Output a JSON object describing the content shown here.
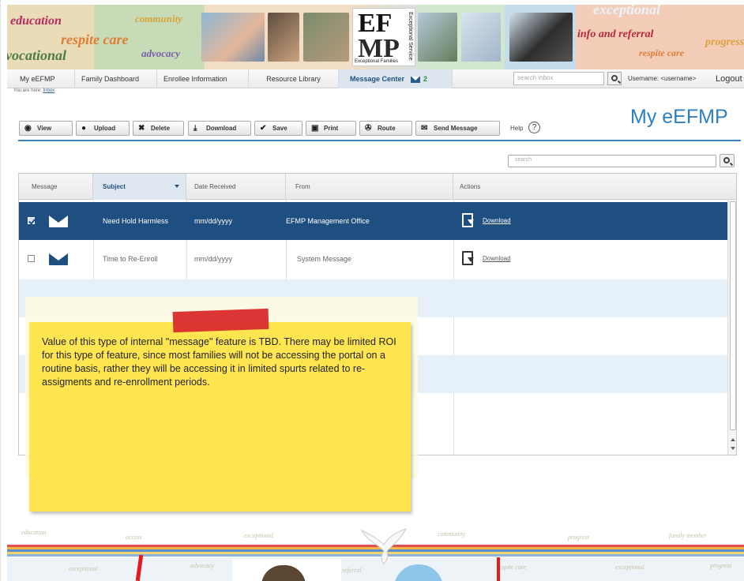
{
  "banner": {
    "words": [
      "education",
      "community",
      "respite care",
      "advocacy",
      "vocational",
      "exceptional",
      "info and referral",
      "progress",
      "respite care"
    ],
    "logo": {
      "top": "EF",
      "bottom": "MP",
      "caption": "Exceptional Families",
      "side": "Exceptional Service"
    }
  },
  "nav": {
    "items": [
      "My eEFMP",
      "Family Dashboard",
      "Enrollee Information",
      "Resource Library",
      "Message Center"
    ],
    "message_count": "2",
    "search_placeholder": "search inbox",
    "username": "Username: <username>",
    "logout": "Logout"
  },
  "breadcrumb": {
    "prefix": "You are here:",
    "link": "Inbox"
  },
  "page_title": "My eEFMP",
  "toolbar": {
    "buttons": [
      "View",
      "Upload",
      "Delete",
      "Download",
      "Save",
      "Print",
      "Route",
      "Send Message"
    ],
    "help": "Help",
    "help_icon": "?"
  },
  "grid": {
    "search_placeholder": "search",
    "columns": [
      "Message",
      "Subject",
      "Date Received",
      "From",
      "Actions"
    ],
    "rows": [
      {
        "subject": "Need Hold Harmless",
        "date": "mm/dd/yyyy",
        "from": "EFMP Management Office",
        "action": "Download",
        "selected": true
      },
      {
        "subject": "Time to Re-Enroll",
        "date": "mm/dd/yyyy",
        "from": "System Message",
        "action": "Download",
        "selected": false
      }
    ]
  },
  "note": {
    "text": "Value of this type of internal \"message\" feature is TBD. There may be limited ROI for this type of feature, since most families will not be accessing the portal on a routine basis, rather they will be accessing it in limited spurts related to re-assigments and re-enrollment periods."
  },
  "footer": {
    "words": [
      "education",
      "access",
      "exceptional",
      "community",
      "progress",
      "family member",
      "exceptional",
      "advocacy",
      "referral",
      "respite care",
      "exceptional",
      "progress"
    ]
  },
  "colors": {
    "accent": "#2e7fc0",
    "selected_row": "#1e4f80",
    "note": "#ffe54f",
    "tape": "#d92b2b"
  }
}
